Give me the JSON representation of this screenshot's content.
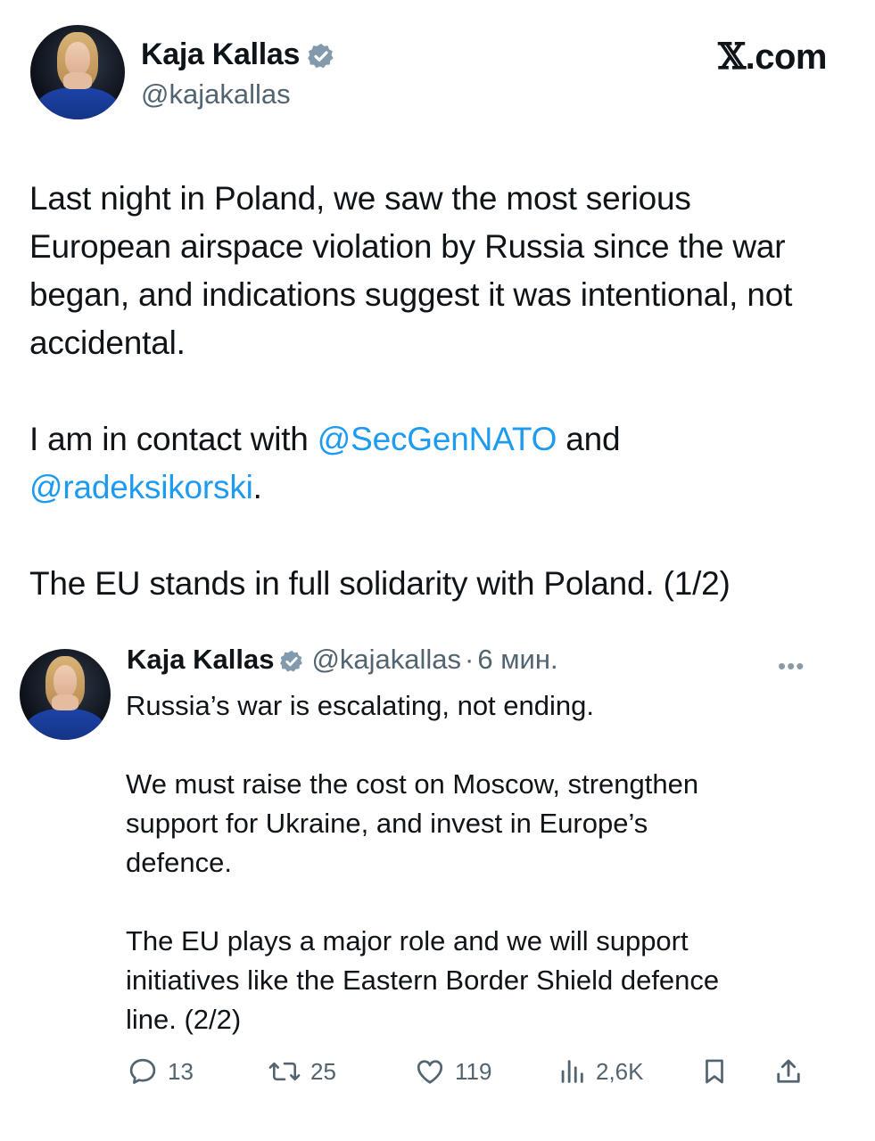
{
  "brand": {
    "logo_mark": "𝕏",
    "logo_text": ".com"
  },
  "main_tweet": {
    "author_name": "Kaja Kallas",
    "handle": "@kajakallas",
    "paragraph1": "Last night in Poland, we saw the most serious European airspace violation by Russia since the war began, and indications suggest it was intentional, not accidental.",
    "p2_prefix": "I am in contact with ",
    "p2_mention1": "@SecGenNATO",
    "p2_mid": " and",
    "p2_mention2": "@radeksikorski",
    "p2_suffix": ".",
    "paragraph3": "The EU stands in full solidarity with Poland. (1/2)"
  },
  "reply_tweet": {
    "author_name": "Kaja Kallas",
    "handle": "@kajakallas",
    "separator": "·",
    "time": "6 мин.",
    "more_label": "•••",
    "paragraph1": "Russia’s war is escalating, not ending.",
    "paragraph2_line1": "We must raise the cost on Moscow, strengthen",
    "paragraph2_line2": "support for Ukraine, and invest in Europe’s",
    "paragraph2_line3": "defence.",
    "paragraph3_line1": "The EU plays a major role and we will support",
    "paragraph3_line2": "initiatives like the Eastern Border Shield defence",
    "paragraph3_line3": "line. (2/2)"
  },
  "actions": {
    "replies": "13",
    "reposts": "25",
    "likes": "119",
    "views": "2,6K"
  },
  "colors": {
    "text": "#0f1419",
    "secondary": "#536471",
    "mention": "#1d9bf0",
    "verified": "#829aab"
  },
  "icons": [
    "verified-badge-icon",
    "reply-icon",
    "repost-icon",
    "like-icon",
    "views-icon",
    "bookmark-icon",
    "share-icon",
    "more-icon"
  ]
}
